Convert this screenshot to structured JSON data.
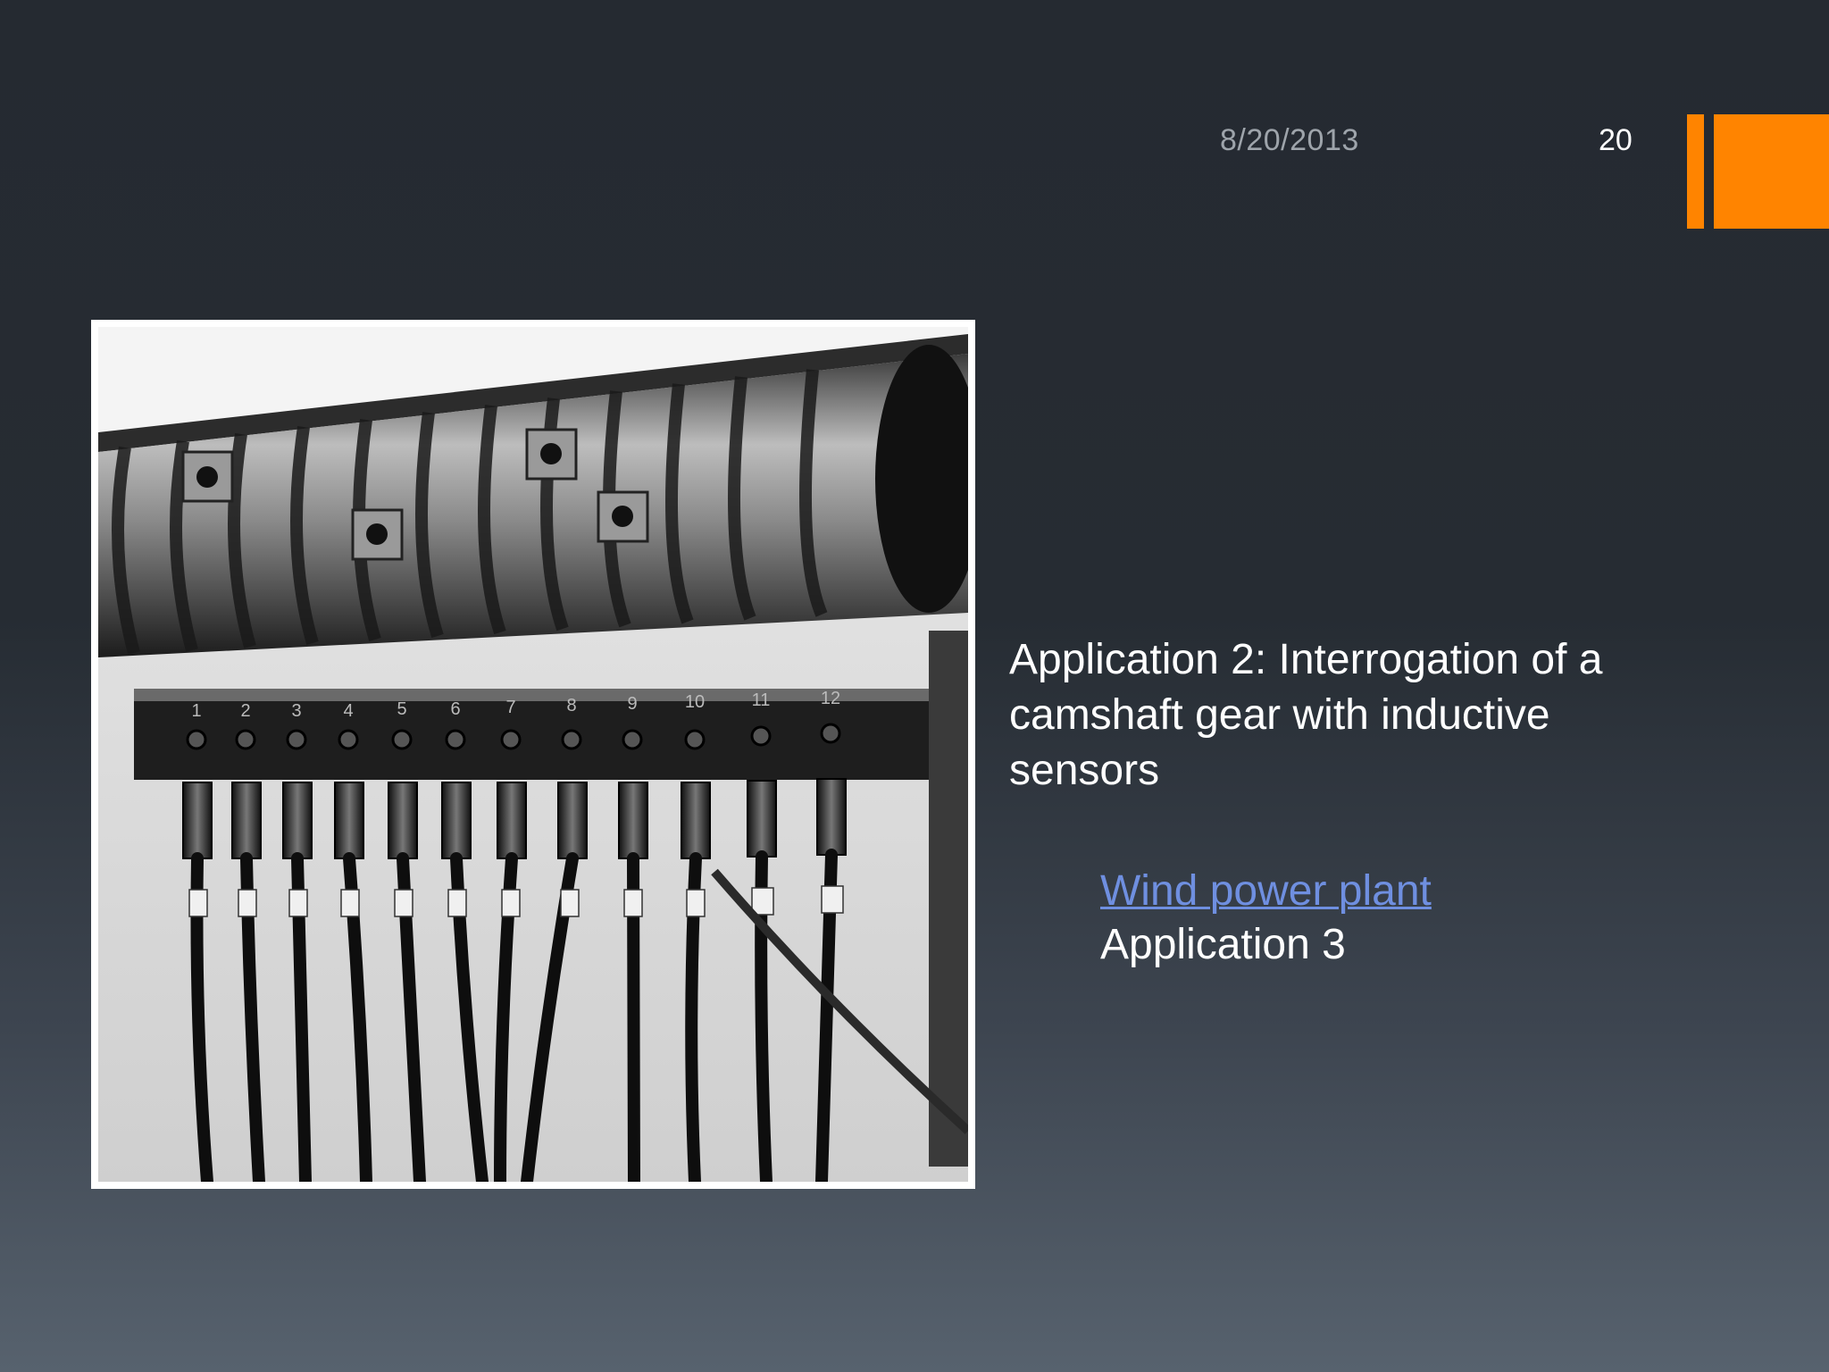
{
  "slide": {
    "date": "8/20/2013",
    "number": "20",
    "accent_color": "#ff8400"
  },
  "content": {
    "heading": "Application 2: Interrogation of a camshaft gear with inductive sensors",
    "link_text": "Wind power plant",
    "link_color": "#6f8fe0",
    "next_item": "Application 3"
  },
  "photo": {
    "subject": "camshaft-with-inductive-sensors-photo",
    "sensor_labels": [
      "1",
      "2",
      "3",
      "4",
      "5",
      "6",
      "7",
      "8",
      "9",
      "10",
      "11",
      "12"
    ]
  }
}
